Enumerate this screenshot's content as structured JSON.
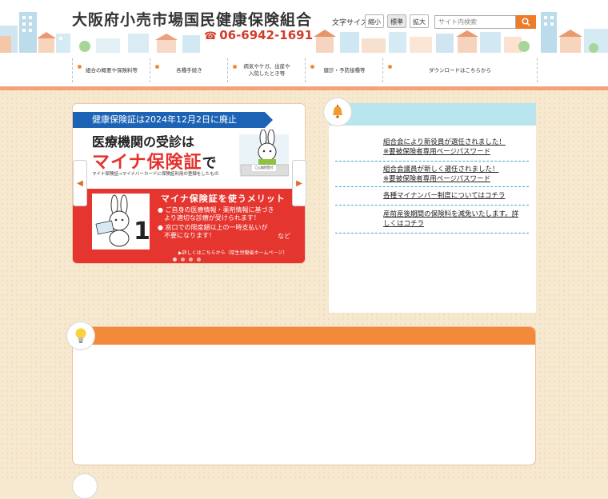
{
  "header": {
    "site_title": "大阪府小売市場国民健康保険組合",
    "phone": "06-6942-1691",
    "font_size": {
      "label": "文字サイズ",
      "options": [
        "縮小",
        "標準",
        "拡大"
      ],
      "selected": "標準"
    },
    "search": {
      "placeholder": "サイト内検索"
    }
  },
  "nav": {
    "items": [
      {
        "label": "組合の概要や保険料等"
      },
      {
        "label": "各種手続き"
      },
      {
        "label": "病気やケガ、出産や\n入院したとき等"
      },
      {
        "label": "健診・予防接種等"
      },
      {
        "label": "ダウンロードはこちらから"
      }
    ]
  },
  "banner": {
    "top_label": "健康保険証は2024年12月2日に廃止",
    "headline_1": "医療機関の受診は",
    "headline_2": "マイナ保険証",
    "headline_2_suffix": "で",
    "small_note": "マイナ保険証→マイナバーカードに保険証利用の登録をしたもの",
    "counter_sign": "〇△病院受付",
    "merit_title": "マイナ保険証を使うメリット",
    "merit_line_1": "● ご自身の医療情報・薬剤情報に基づき",
    "merit_line_2": "より適切な診療が受けられます！",
    "merit_line_3": "● 窓口での限度額以上の一時支払いが",
    "merit_line_4": "不要になります！",
    "merit_etc": "など",
    "merit_link": "▶詳しくはこちらから（厚生労働省ホームページ）",
    "illus_number": "1",
    "slides": {
      "count": 4,
      "active": 1
    },
    "prev_arrow": "◀",
    "next_arrow": "▶"
  },
  "news": {
    "items": [
      {
        "line1": "組合会により新役員が選任されました！",
        "line2": "※要被保険者専用ページパスワード"
      },
      {
        "line1": "組合会議員が新しく選任されました！",
        "line2": "※要被保険者専用ページパスワード"
      },
      {
        "line1": "各種マイナンバー制度についてはコチラ",
        "line2": ""
      },
      {
        "line1": "産前産後期間の保険料を減免いたします。詳",
        "line2": "しくはコチラ"
      }
    ]
  },
  "colors": {
    "accent": "#f28a3a",
    "nav_border": "#f3a37a",
    "banner_red": "#e5352f",
    "banner_blue": "#1d63b5",
    "news_bar": "#b9e6ee",
    "news_separator": "#39a3d3",
    "page_bg": "#f6e9cf"
  },
  "icons": {
    "phone": "phone-icon",
    "search": "search-icon",
    "bell": "bell-icon",
    "bulb": "lightbulb-icon"
  }
}
